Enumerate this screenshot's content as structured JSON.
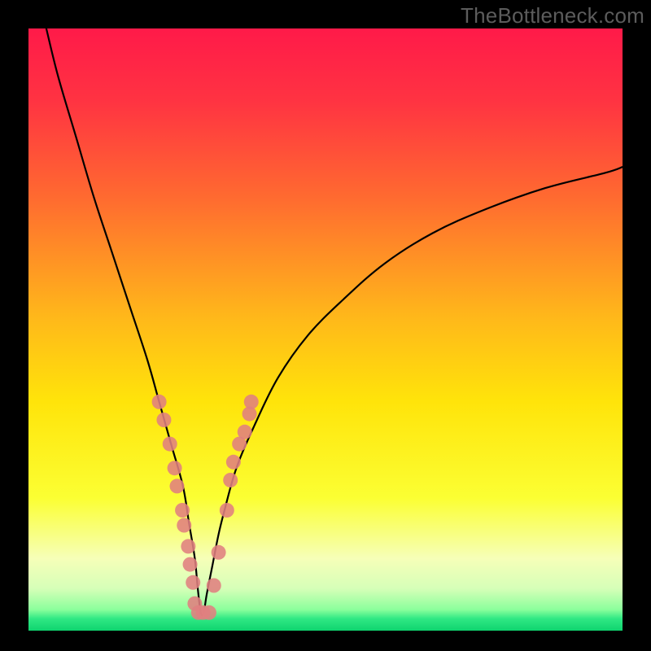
{
  "watermark": "TheBottleneck.com",
  "plot": {
    "outer_w": 800,
    "outer_h": 800,
    "inner_left": 35,
    "inner_top": 35,
    "inner_w": 730,
    "inner_h": 740,
    "gradient_stops": [
      {
        "pct": 0,
        "color": "#ff1a49"
      },
      {
        "pct": 12,
        "color": "#ff3342"
      },
      {
        "pct": 28,
        "color": "#ff6a30"
      },
      {
        "pct": 48,
        "color": "#ffb81a"
      },
      {
        "pct": 62,
        "color": "#ffe40a"
      },
      {
        "pct": 78,
        "color": "#fbff33"
      },
      {
        "pct": 88,
        "color": "#f6ffb8"
      },
      {
        "pct": 93,
        "color": "#d6ffb8"
      },
      {
        "pct": 96.5,
        "color": "#8bff9c"
      },
      {
        "pct": 98,
        "color": "#30e884"
      },
      {
        "pct": 100,
        "color": "#0fd46f"
      }
    ]
  },
  "chart_data": {
    "type": "line",
    "title": "",
    "xlabel": "",
    "ylabel": "",
    "xlim": [
      0,
      100
    ],
    "ylim": [
      0,
      100
    ],
    "notch_x": 29,
    "series": [
      {
        "name": "bottleneck-curve",
        "color": "#000000",
        "x": [
          3,
          5,
          8,
          11,
          14,
          17,
          20,
          22,
          24,
          26,
          27,
          28,
          28.5,
          29,
          29.5,
          30,
          31,
          32,
          33,
          35,
          38,
          42,
          47,
          53,
          60,
          68,
          77,
          87,
          97,
          100
        ],
        "y": [
          100,
          92,
          82,
          72,
          63,
          54,
          45,
          38,
          31,
          24,
          18,
          12,
          7,
          3,
          3,
          6,
          11,
          16,
          20,
          27,
          34,
          42,
          49,
          55,
          61,
          66,
          70,
          73.5,
          76,
          77
        ]
      }
    ],
    "markers": {
      "name": "sample-points",
      "color": "#e08080",
      "r": 9,
      "points": [
        {
          "x": 22.0,
          "y": 38
        },
        {
          "x": 22.8,
          "y": 35
        },
        {
          "x": 23.8,
          "y": 31
        },
        {
          "x": 24.6,
          "y": 27
        },
        {
          "x": 25.0,
          "y": 24
        },
        {
          "x": 25.9,
          "y": 20
        },
        {
          "x": 26.2,
          "y": 17.5
        },
        {
          "x": 26.9,
          "y": 14
        },
        {
          "x": 27.2,
          "y": 11
        },
        {
          "x": 27.7,
          "y": 8
        },
        {
          "x": 28.0,
          "y": 4.5
        },
        {
          "x": 28.6,
          "y": 3
        },
        {
          "x": 29.4,
          "y": 3
        },
        {
          "x": 30.4,
          "y": 3
        },
        {
          "x": 31.2,
          "y": 7.5
        },
        {
          "x": 32.0,
          "y": 13
        },
        {
          "x": 33.4,
          "y": 20
        },
        {
          "x": 34.0,
          "y": 25
        },
        {
          "x": 34.5,
          "y": 28
        },
        {
          "x": 35.5,
          "y": 31
        },
        {
          "x": 36.4,
          "y": 33
        },
        {
          "x": 37.2,
          "y": 36
        },
        {
          "x": 37.5,
          "y": 38
        }
      ]
    }
  }
}
